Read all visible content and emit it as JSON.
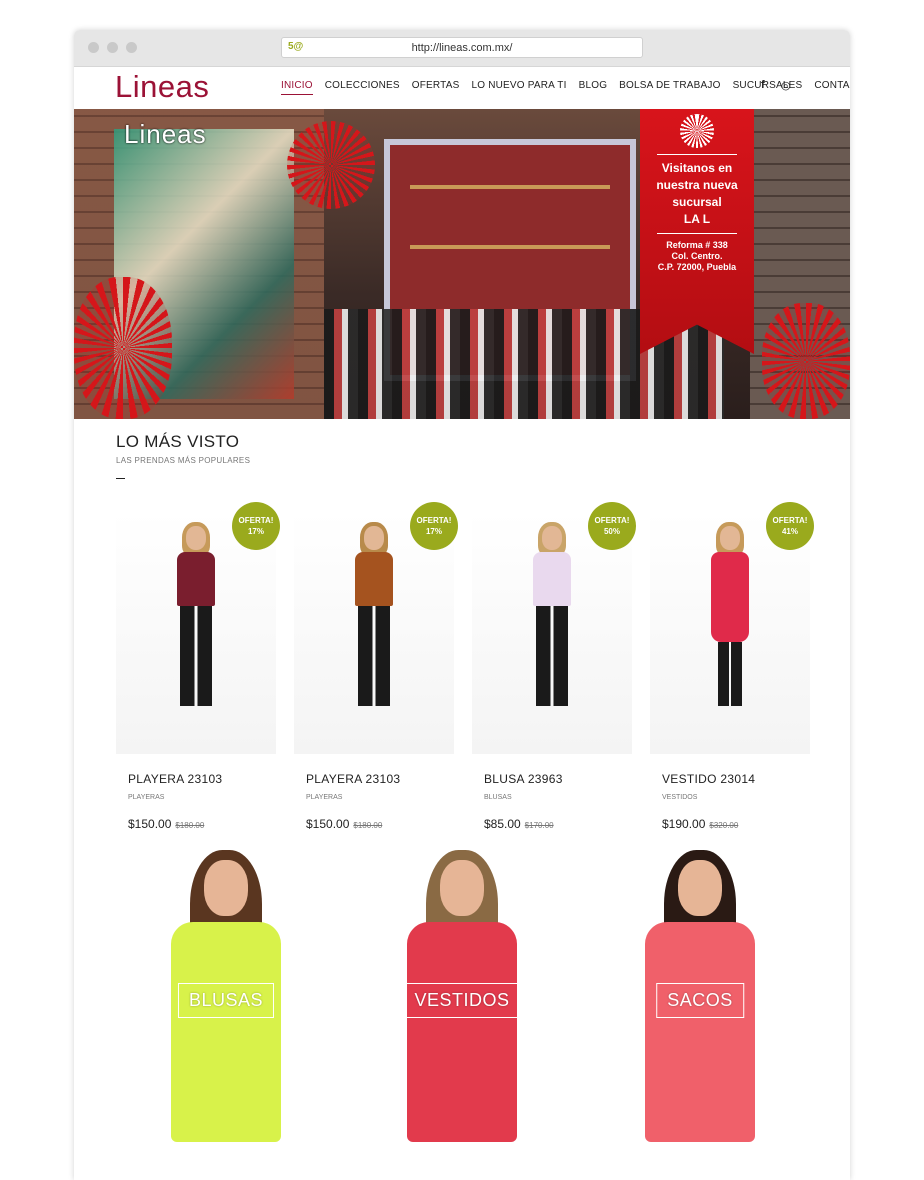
{
  "browser": {
    "url": "http://lineas.com.mx/",
    "favicon": "5@"
  },
  "header": {
    "logo": "Lineas",
    "nav": [
      "INICIO",
      "COLECCIONES",
      "OFERTAS",
      "LO NUEVO PARA TI",
      "BLOG",
      "BOLSA DE TRABAJO",
      "SUCURSALES",
      "CONTACTO"
    ],
    "social": [
      "f",
      "◎"
    ]
  },
  "hero": {
    "logo": "Lineas",
    "banner": {
      "line1": "Visitanos en",
      "line2": "nuestra nueva",
      "line3": "sucursal",
      "line4": "LA L",
      "addr1": "Reforma # 338",
      "addr2": "Col. Centro.",
      "addr3": "C.P. 72000, Puebla"
    }
  },
  "section": {
    "title": "LO MÁS VISTO",
    "subtitle": "LAS PRENDAS MÁS POPULARES"
  },
  "products": [
    {
      "badge1": "OFERTA!",
      "badge2": "17%",
      "name": "PLAYERA 23103",
      "category": "PLAYERAS",
      "price": "$150.00",
      "old_price": "$180.00",
      "top_color": "#7a1e2e"
    },
    {
      "badge1": "OFERTA!",
      "badge2": "17%",
      "name": "PLAYERA 23103",
      "category": "PLAYERAS",
      "price": "$150.00",
      "old_price": "$180.00",
      "top_color": "#a5531f"
    },
    {
      "badge1": "OFERTA!",
      "badge2": "50%",
      "name": "BLUSA 23963",
      "category": "BLUSAS",
      "price": "$85.00",
      "old_price": "$170.00",
      "top_color": "#e9d9ee"
    },
    {
      "badge1": "OFERTA!",
      "badge2": "41%",
      "name": "VESTIDO 23014",
      "category": "VESTIDOS",
      "price": "$190.00",
      "old_price": "$320.00",
      "top_color": "#e02a4a"
    }
  ],
  "categories": [
    {
      "label": "BLUSAS",
      "color": "#d8f24a"
    },
    {
      "label": "VESTIDOS",
      "color": "#e23a4c"
    },
    {
      "label": "SACOS",
      "color": "#f0606a"
    }
  ],
  "colors": {
    "brand": "#9b1236",
    "badge": "#9aaa1d",
    "banner": "#d8141b"
  }
}
